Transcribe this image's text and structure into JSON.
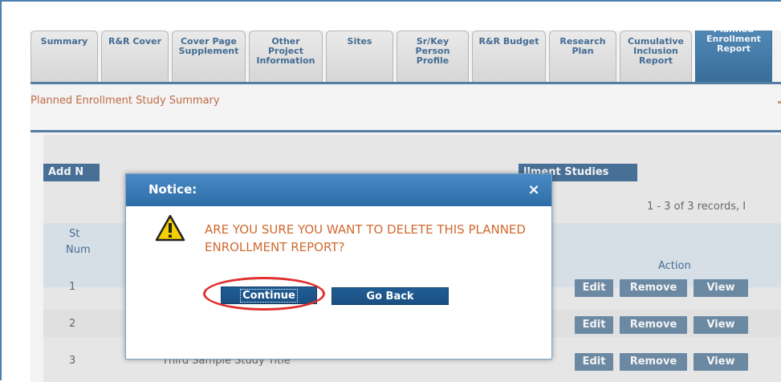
{
  "tabs": [
    {
      "label": "Summary",
      "active": false
    },
    {
      "label": "R&R Cover",
      "active": false
    },
    {
      "label": "Cover Page\nSupplement",
      "active": false
    },
    {
      "label": "Other\nProject\nInformation",
      "active": false
    },
    {
      "label": "Sites",
      "active": false
    },
    {
      "label": "Sr/Key\nPerson\nProfile",
      "active": false
    },
    {
      "label": "R&R Budget",
      "active": false
    },
    {
      "label": "Research\nPlan",
      "active": false
    },
    {
      "label": "Cumulative\nInclusion\nReport",
      "active": false
    },
    {
      "label": "Planned\nEnrollment\nReport",
      "active": true
    }
  ],
  "section_title": "Planned Enrollment Study Summary",
  "toolbar": {
    "add_label": "Add N",
    "enrollment_label": "llment Studies"
  },
  "records_info": "1 - 3 of 3 records, I",
  "table": {
    "col_study_line1": "St",
    "col_study_line2": "Num",
    "col_action": "Action",
    "rows": [
      {
        "num": "1",
        "title": ""
      },
      {
        "num": "2",
        "title": ""
      },
      {
        "num": "3",
        "title": "Third Sample Study Title"
      }
    ],
    "actions": {
      "edit": "Edit",
      "remove": "Remove",
      "view": "View"
    }
  },
  "dialog": {
    "title": "Notice:",
    "close": "×",
    "icon": "warning-icon",
    "message": "ARE YOU SURE YOU WANT TO DELETE THIS PLANNED ENROLLMENT REPORT?",
    "continue_label": "Continue",
    "goback_label": "Go Back"
  },
  "colors": {
    "tab_active": "#2e6ea8",
    "rule_blue": "#3e6f9e",
    "title_orange": "#c05a2a",
    "message_orange": "#d06a30",
    "button_blue": "#1f5d96",
    "highlight_red": "#e03030"
  }
}
